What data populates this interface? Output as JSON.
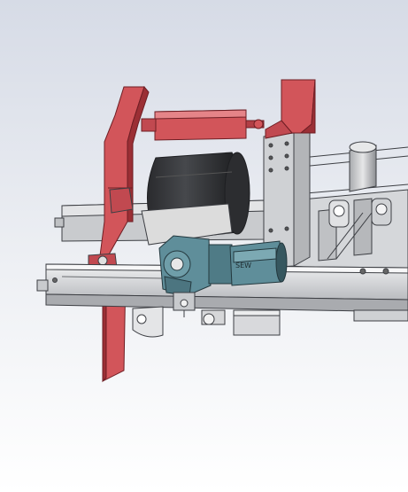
{
  "viewport": {
    "background_top": "#d9dee8",
    "background_bottom": "#ffffff"
  },
  "palette": {
    "steel_light": "#e4e5e7",
    "steel_mid": "#c8cacd",
    "steel_dark": "#8f9296",
    "edge": "#3d3f44",
    "drum_dark": "#1e1f22",
    "drum_band": "#d3d3d3",
    "red_part": "#d2555a",
    "red_dark": "#9b2f35",
    "motor_blue": "#5f8e9a",
    "motor_dark": "#36575f"
  },
  "motor_label": "SEW"
}
